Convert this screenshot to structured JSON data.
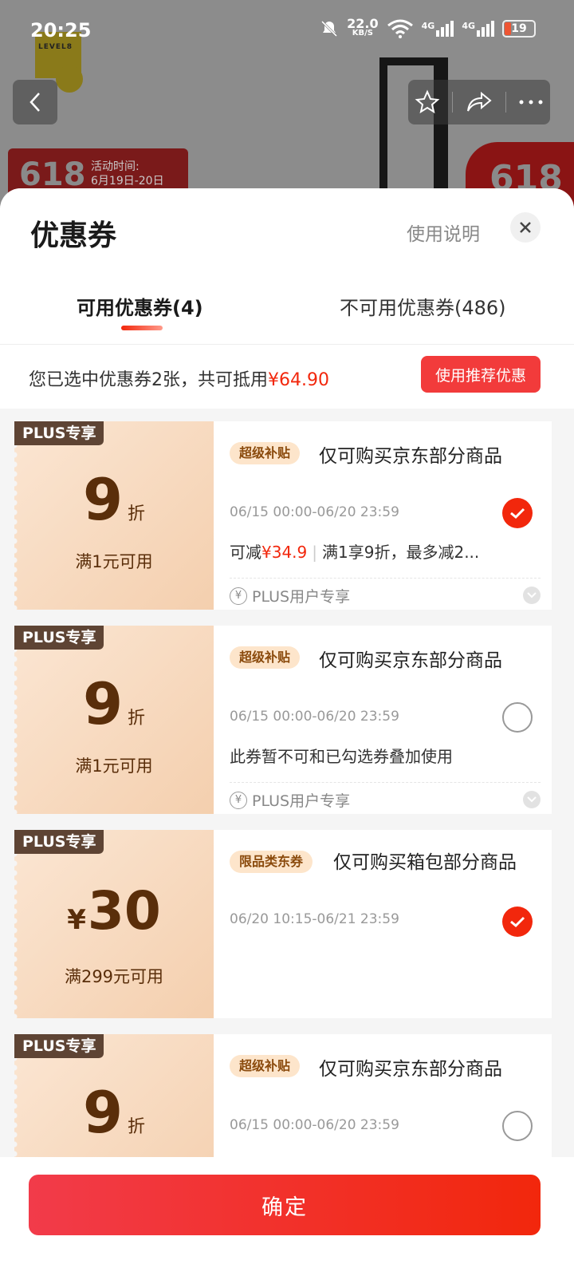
{
  "status_bar": {
    "time": "20:25",
    "net_speed": "22.0",
    "net_unit": "KB/S",
    "signal_1": "4G",
    "signal_2": "4G",
    "battery": "19"
  },
  "background": {
    "brand": "LEVEL8",
    "promo_big": "618",
    "promo_line1": "活动时间:",
    "promo_line2": "6月19日-20日",
    "promo_right": "618"
  },
  "sheet": {
    "title": "优惠券",
    "help": "使用说明",
    "tabs": [
      {
        "label": "可用优惠券(4)"
      },
      {
        "label": "不可用优惠券(486)"
      }
    ],
    "summary_prefix": "您已选中优惠券2张，共可抵用",
    "summary_amount": "¥64.90",
    "recommend_button": "使用推荐优惠"
  },
  "coupons": [
    {
      "badge": "PLUS专享",
      "value": "9",
      "unit": "折",
      "condition": "满1元可用",
      "tag": "超级补贴",
      "title": "仅可购买京东部分商品",
      "date": "06/15 00:00-06/20 23:59",
      "desc_prefix": "可减",
      "desc_amount": "¥34.9",
      "desc_rule": "满1享9折，最多减2...",
      "footer": "PLUS用户专享",
      "selected": true
    },
    {
      "badge": "PLUS专享",
      "value": "9",
      "unit": "折",
      "condition": "满1元可用",
      "tag": "超级补贴",
      "title": "仅可购买京东部分商品",
      "date": "06/15 00:00-06/20 23:59",
      "desc": "此券暂不可和已勾选券叠加使用",
      "footer": "PLUS用户专享",
      "selected": false
    },
    {
      "badge": "PLUS专享",
      "currency": "¥",
      "value": "30",
      "condition": "满299元可用",
      "tag": "限品类东券",
      "title": "仅可购买箱包部分商品",
      "date": "06/20 10:15-06/21 23:59",
      "selected": true
    },
    {
      "badge": "PLUS专享",
      "value": "9",
      "unit": "折",
      "tag": "超级补贴",
      "title": "仅可购买京东部分商品",
      "date": "06/15 00:00-06/20 23:59",
      "selected": false
    }
  ],
  "confirm_button": "确定"
}
